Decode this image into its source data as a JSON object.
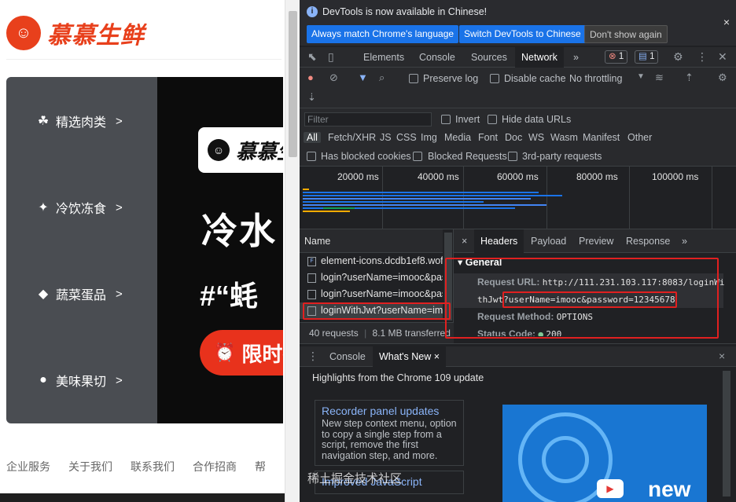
{
  "site": {
    "brand": "慕慕生鲜",
    "categories": [
      {
        "label": "精选肉类",
        "arrow": ">"
      },
      {
        "label": "冷饮冻食",
        "arrow": ">"
      },
      {
        "label": "蔬菜蛋品",
        "arrow": ">"
      },
      {
        "label": "美味果切",
        "arrow": ">"
      }
    ],
    "banner": {
      "brand": "慕慕生",
      "headline": "冷水",
      "subline": "#“蚝",
      "button": "限时抢"
    },
    "footer_links": [
      "企业服务",
      "关于我们",
      "联系我们",
      "合作招商",
      "帮"
    ]
  },
  "devtools": {
    "infobar": {
      "message": "DevTools is now available in Chinese!",
      "btn_match": "Always match Chrome's language",
      "btn_switch": "Switch DevTools to Chinese",
      "btn_dismiss": "Don't show again",
      "close": "×"
    },
    "tabs": [
      "Elements",
      "Console",
      "Sources",
      "Network"
    ],
    "more": "»",
    "errors_count": "1",
    "messages_count": "1",
    "toolbar": {
      "preserve_log": "Preserve log",
      "disable_cache": "Disable cache",
      "throttling": "No throttling"
    },
    "filter": {
      "placeholder": "Filter",
      "invert": "Invert",
      "hide_data_urls": "Hide data URLs",
      "types": [
        "All",
        "Fetch/XHR",
        "JS",
        "CSS",
        "Img",
        "Media",
        "Font",
        "Doc",
        "WS",
        "Wasm",
        "Manifest",
        "Other"
      ],
      "blocked_cookies": "Has blocked cookies",
      "blocked_requests": "Blocked Requests",
      "third_party": "3rd-party requests"
    },
    "timeline_ticks": [
      "20000 ms",
      "40000 ms",
      "60000 ms",
      "80000 ms",
      "100000 ms"
    ],
    "requests": {
      "header": "Name",
      "rows": [
        "element-icons.dcdb1ef8.woff",
        "login?userName=imooc&pas",
        "login?userName=imooc&pas",
        "loginWithJwt?userName=imo"
      ],
      "status": "40 requests",
      "transferred": "8.1 MB transferred"
    },
    "detail": {
      "close": "×",
      "tabs": [
        "Headers",
        "Payload",
        "Preview",
        "Response"
      ],
      "more": "»",
      "section": "General",
      "url_key": "Request URL:",
      "url_value": "http://111.231.103.117:8083/loginWi",
      "url_cont": "thJwt",
      "url_query": "?userName=imooc&password=12345678",
      "method_key": "Request Method:",
      "method_value": "OPTIONS",
      "status_key": "Status Code:",
      "status_value": "200"
    },
    "drawer": {
      "tabs": [
        "Console",
        "What's New"
      ],
      "close": "×",
      "highlights": "Highlights from the Chrome 109 update",
      "cards": [
        {
          "title": "Recorder panel updates",
          "desc": "New step context menu, option to copy a single step from a script, remove the first navigation step, and more."
        },
        {
          "title": "Improved JavaScript",
          "desc": ""
        }
      ],
      "new_label": "new",
      "watermark": "稀土掘金技术社区"
    }
  }
}
